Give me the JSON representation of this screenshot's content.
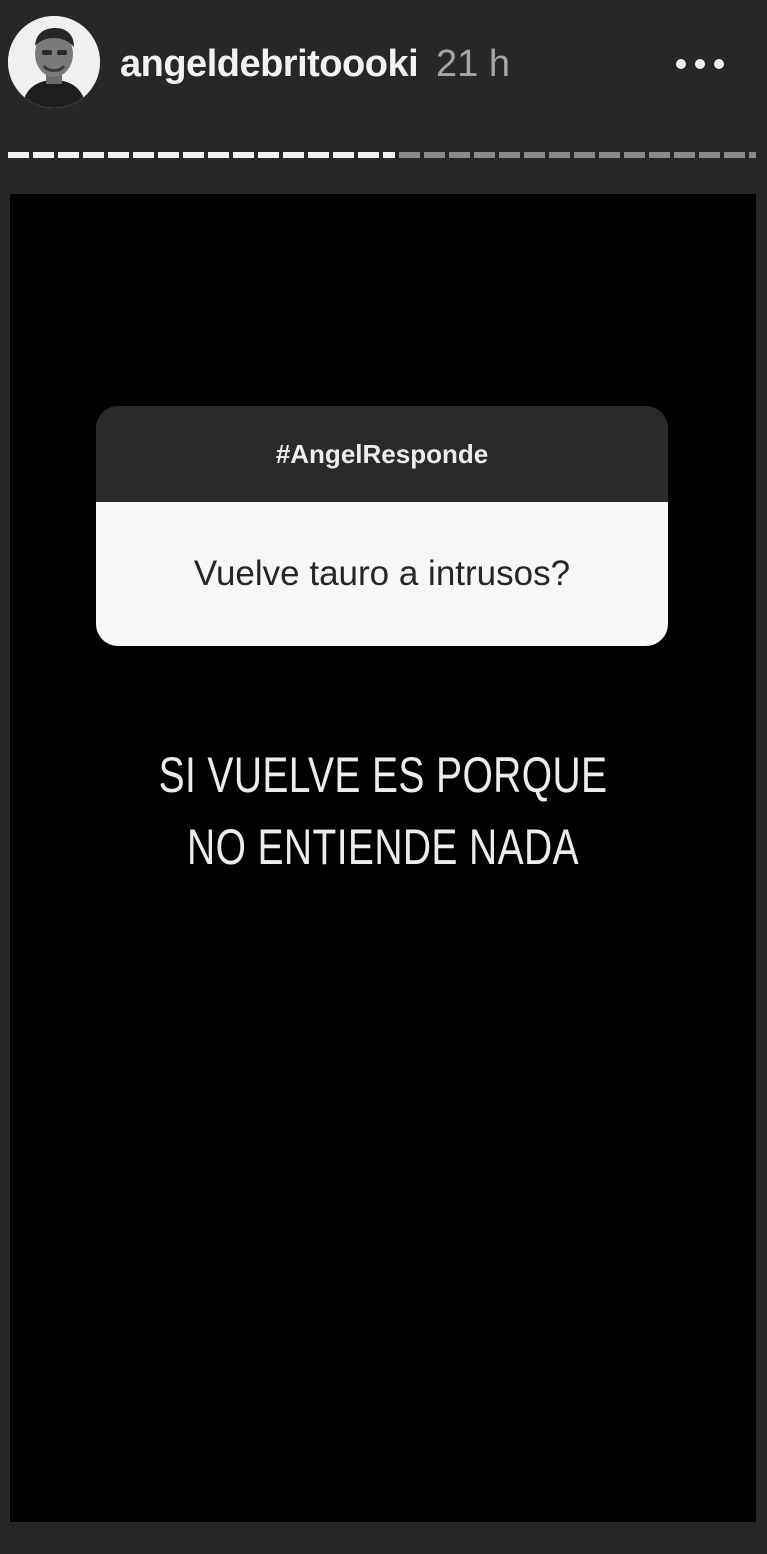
{
  "header": {
    "username": "angeldebritoooki",
    "time": "21 h",
    "more_icon": "more-horizontal-icon"
  },
  "story": {
    "progress_fraction": 0.52,
    "question_box": {
      "title": "#AngelResponde",
      "question": "Vuelve tauro a intrusos?"
    },
    "answer_lines": [
      "SI VUELVE ES PORQUE",
      "NO ENTIENDE NADA"
    ]
  }
}
